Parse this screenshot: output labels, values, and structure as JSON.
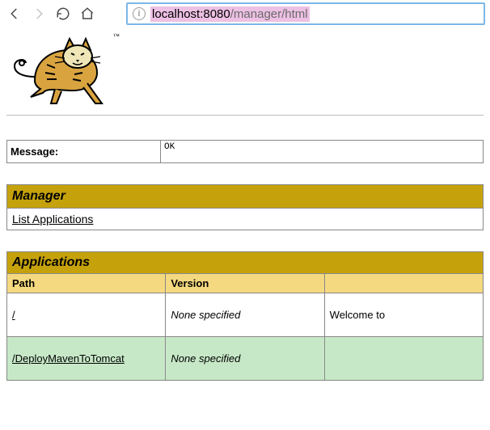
{
  "browser": {
    "url_host": "localhost",
    "url_port": ":8080",
    "url_path": "/manager/html"
  },
  "logo": {
    "tm": "™"
  },
  "message": {
    "label": "Message:",
    "value": "OK"
  },
  "manager": {
    "header": "Manager",
    "list_link": "List Applications"
  },
  "applications": {
    "header": "Applications",
    "col_path": "Path",
    "col_version": "Version",
    "col_display": "",
    "rows": [
      {
        "path": "/",
        "version": "None specified",
        "display": "Welcome to"
      },
      {
        "path": "/DeployMavenToTomcat",
        "version": "None specified",
        "display": ""
      }
    ]
  }
}
